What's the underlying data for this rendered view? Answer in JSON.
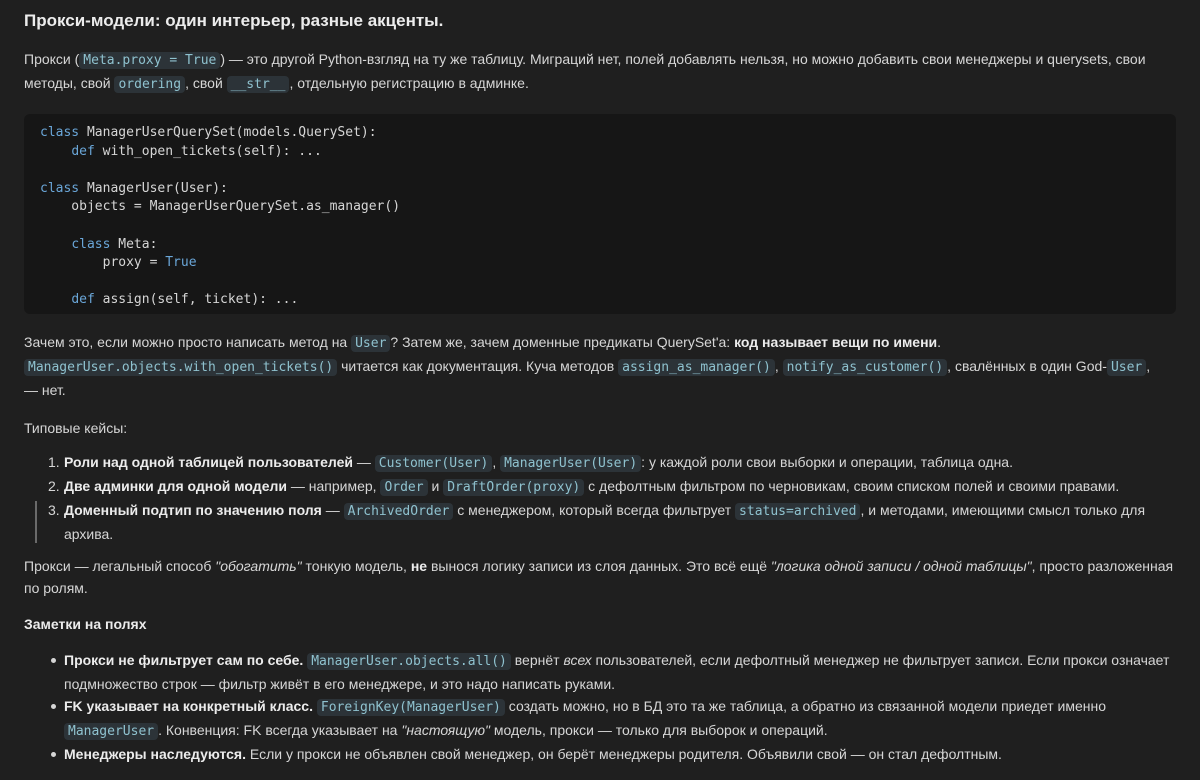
{
  "title": "Прокси-модели: один интерьер, разные акценты.",
  "intro": {
    "t1": "Прокси (",
    "c1": "Meta.proxy = True",
    "t2": ") — это другой Python-взгляд на ту же таблицу. Миграций нет, полей добавлять нельзя, но можно добавить свои менеджеры и querysets, свои методы, свой ",
    "c2": "ordering",
    "t3": ", свой ",
    "c3": "__str__",
    "t4": ", отдельную регистрацию в админке."
  },
  "code": {
    "l1_kw": "class",
    "l1_rest": " ManagerUserQuerySet(models.QuerySet):",
    "l2_ind": "    ",
    "l2_kw": "def",
    "l2_rest": " with_open_tickets(self): ...",
    "l4_kw": "class",
    "l4_rest": " ManagerUser(User):",
    "l5": "    objects = ManagerUserQuerySet.as_manager()",
    "l7_ind": "    ",
    "l7_kw": "class",
    "l7_rest": " Meta:",
    "l8_a": "        proxy = ",
    "l8_b": "True",
    "l10_ind": "    ",
    "l10_kw": "def",
    "l10_rest": " assign(self, ticket): ..."
  },
  "why": {
    "t1": "Зачем это, если можно просто написать метод на ",
    "c1": "User",
    "t2": "? Затем же, зачем доменные предикаты QuerySet'a: ",
    "b1": "код называет вещи по имени",
    "t3": ".",
    "c2": "ManagerUser.objects.with_open_tickets()",
    "t4": " читается как документация. Куча методов ",
    "c3": "assign_as_manager()",
    "t5": ", ",
    "c4": "notify_as_customer()",
    "t6": ", свалённых в один God-",
    "c5": "User",
    "t7": ",",
    "t8": "— нет."
  },
  "cases_title": "Типовые кейсы:",
  "cases": [
    {
      "num": "1.",
      "b": "Роли над одной таблицей пользователей",
      "t1": " — ",
      "c1": "Customer(User)",
      "t2": ", ",
      "c2": "ManagerUser(User)",
      "t3": ": у каждой роли свои выборки и операции, таблица одна."
    },
    {
      "num": "2.",
      "b": "Две админки для одной модели",
      "t1": " — например, ",
      "c1": "Order",
      "t2": " и ",
      "c2": "DraftOrder(proxy)",
      "t3": " с дефолтным фильтром по черновикам, своим списком полей и своими правами."
    },
    {
      "num": "3.",
      "b": "Доменный подтип по значению поля",
      "t1": " — ",
      "c1": "ArchivedOrder",
      "t2": " с менеджером, который всегда фильтрует ",
      "c2": "status=archived",
      "t3": ", и методами, имеющими смысл только для архива."
    }
  ],
  "summary": {
    "t1": "Прокси — легальный способ ",
    "i1": "\"обогатить\"",
    "t2": " тонкую модель, ",
    "b1": "не",
    "t3": " вынося логику записи из слоя данных. Это всё ещё ",
    "i2": "\"логика одной записи / одной таблицы\"",
    "t4": ", просто разложенная по ролям."
  },
  "notes_title": "Заметки на полях",
  "notes": [
    {
      "b": "Прокси не фильтрует сам по себе.",
      "t1": " ",
      "c1": "ManagerUser.objects.all()",
      "t2": " вернёт ",
      "i1": "всех",
      "t3": " пользователей, если дефолтный менеджер не фильтрует записи. Если прокси означает подмножество строк — фильтр живёт в его менеджере, и это надо написать руками."
    },
    {
      "b": "FK указывает на конкретный класс.",
      "t1": " ",
      "c1": "ForeignKey(ManagerUser)",
      "t2": " создать можно, но в БД это та же таблица, а обратно из связанной модели приедет именно ",
      "c2": "ManagerUser",
      "t3": ". Конвенция: FK всегда указывает на ",
      "i1": "\"настоящую\"",
      "t4": " модель, прокси — только для выборок и операций."
    },
    {
      "b": "Менеджеры наследуются.",
      "t1": " Если у прокси не объявлен свой менеджер, он берёт менеджеры родителя. Объявили свой — он стал дефолтным."
    }
  ]
}
